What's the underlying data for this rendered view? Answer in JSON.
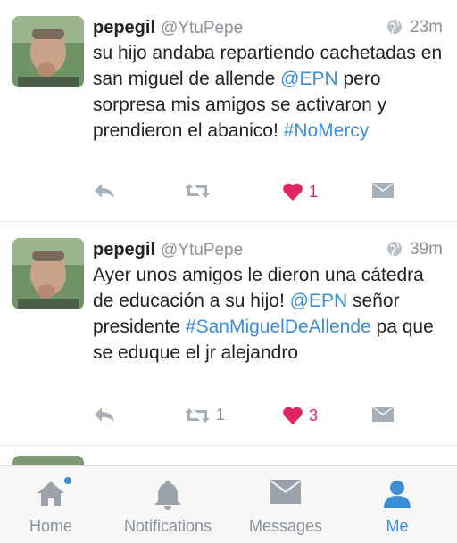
{
  "colors": {
    "accent": "#3b8ed6",
    "like": "#e0245e",
    "muted": "#8a9199"
  },
  "tweets": [
    {
      "name": "pepegil",
      "handle": "@YtuPepe",
      "time": "23m",
      "text_parts": [
        {
          "t": "su hijo andaba repartiendo cachetadas en san miguel de allende ",
          "link": false
        },
        {
          "t": "@EPN",
          "link": true
        },
        {
          "t": " pero sorpresa mis amigos se activaron y prendieron el abanico! ",
          "link": false
        },
        {
          "t": "#NoMercy",
          "link": true
        }
      ],
      "retweet_count": "",
      "like_count": "1",
      "liked": true
    },
    {
      "name": "pepegil",
      "handle": "@YtuPepe",
      "time": "39m",
      "text_parts": [
        {
          "t": "Ayer unos amigos le dieron una cátedra de educación a su hijo! ",
          "link": false
        },
        {
          "t": "@EPN",
          "link": true
        },
        {
          "t": " señor presidente ",
          "link": false
        },
        {
          "t": "#SanMiguelDeAllende",
          "link": true
        },
        {
          "t": " pa que se eduque el jr alejandro",
          "link": false
        }
      ],
      "retweet_count": "1",
      "like_count": "3",
      "liked": true
    }
  ],
  "tabbar": {
    "home": "Home",
    "notifications": "Notifications",
    "messages": "Messages",
    "me": "Me"
  }
}
